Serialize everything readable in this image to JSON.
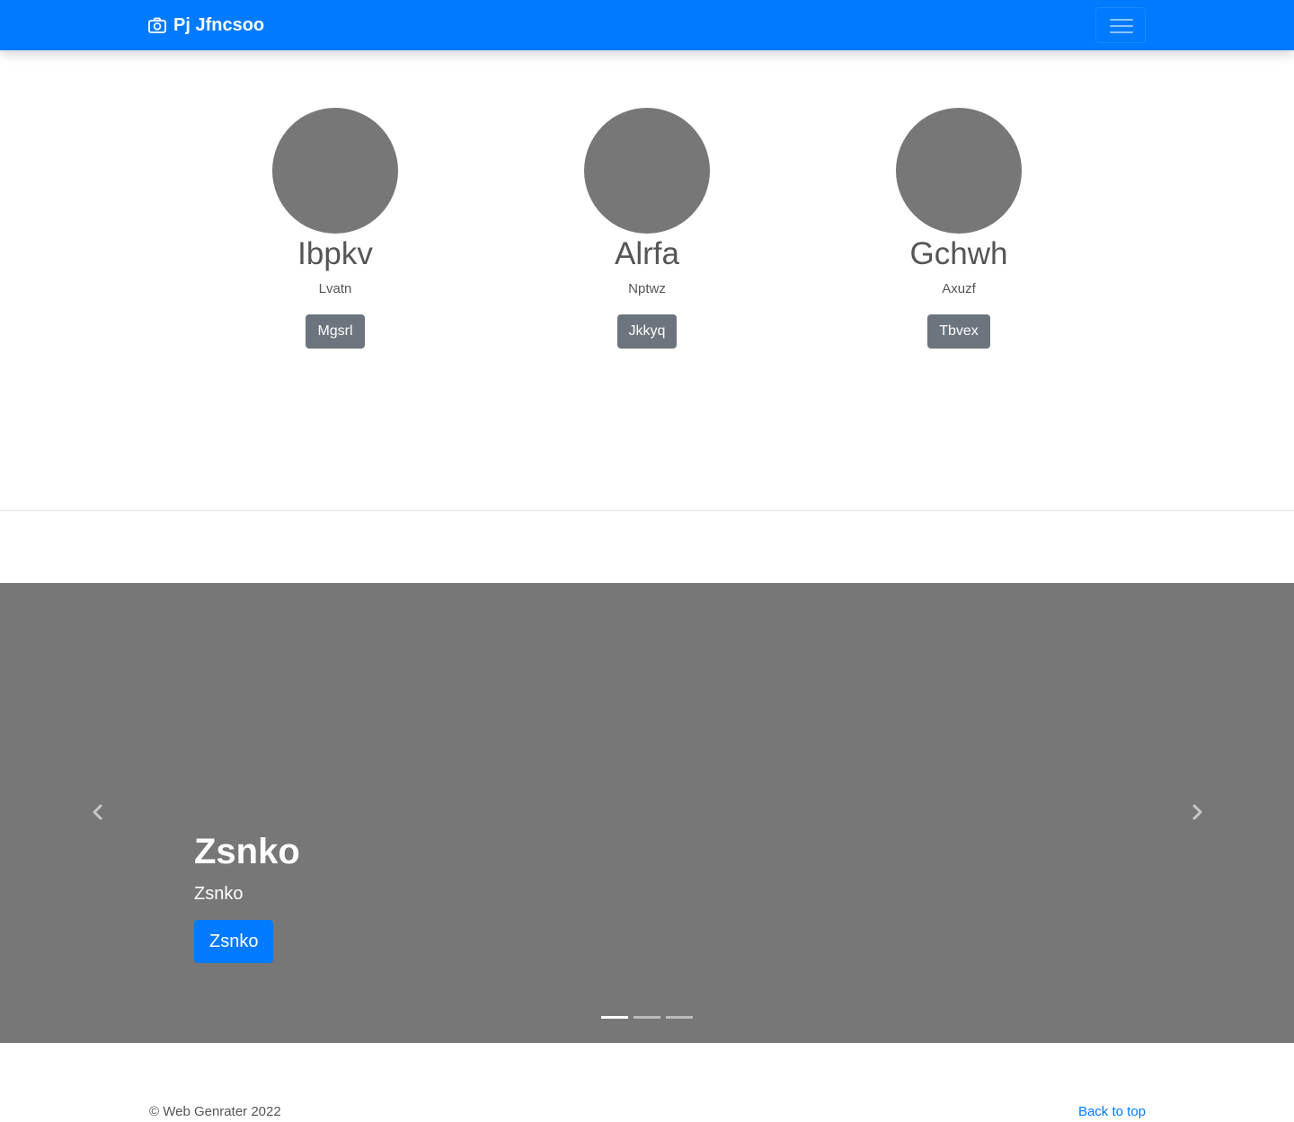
{
  "navbar": {
    "brand": "Pj Jfncsoo",
    "brand_icon": "camera-icon",
    "toggler_icon": "hamburger-icon",
    "background": "#007bff"
  },
  "members": [
    {
      "name": "Ibpkv",
      "role": "Lvatn",
      "button": "Mgsrl"
    },
    {
      "name": "Alrfa",
      "role": "Nptwz",
      "button": "Jkkyq"
    },
    {
      "name": "Gchwh",
      "role": "Axuzf",
      "button": "Tbvex"
    }
  ],
  "carousel": {
    "title": "Zsnko",
    "text": "Zsnko",
    "button": "Zsnko",
    "slide_count": 3,
    "active_slide": 1,
    "prev_icon": "chevron-left-icon",
    "next_icon": "chevron-right-icon",
    "background": "#777777"
  },
  "footer": {
    "copyright": "© Web Genrater 2022",
    "back_to_top": "Back to top"
  }
}
